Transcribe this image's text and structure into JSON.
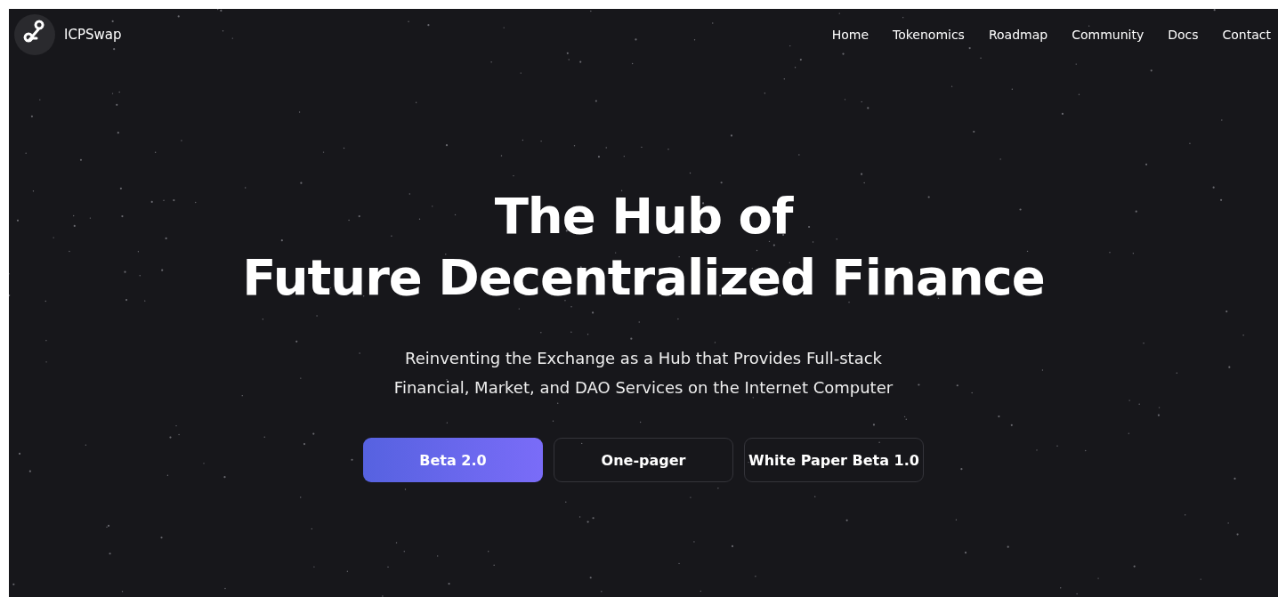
{
  "brand": {
    "name": "ICPSwap"
  },
  "nav": [
    {
      "label": "Home"
    },
    {
      "label": "Tokenomics"
    },
    {
      "label": "Roadmap"
    },
    {
      "label": "Community"
    },
    {
      "label": "Docs"
    },
    {
      "label": "Contact"
    }
  ],
  "hero": {
    "title_lines": [
      "The Hub of",
      "Future Decentralized Finance"
    ],
    "subtitle_lines": [
      "Reinventing the Exchange as a Hub that Provides Full-stack",
      "Financial, Market, and DAO Services on the Internet Computer"
    ],
    "buttons": [
      {
        "label": "Beta 2.0",
        "kind": "primary"
      },
      {
        "label": "One-pager",
        "kind": "outline"
      },
      {
        "label": "White Paper Beta 1.0",
        "kind": "outline"
      }
    ]
  }
}
